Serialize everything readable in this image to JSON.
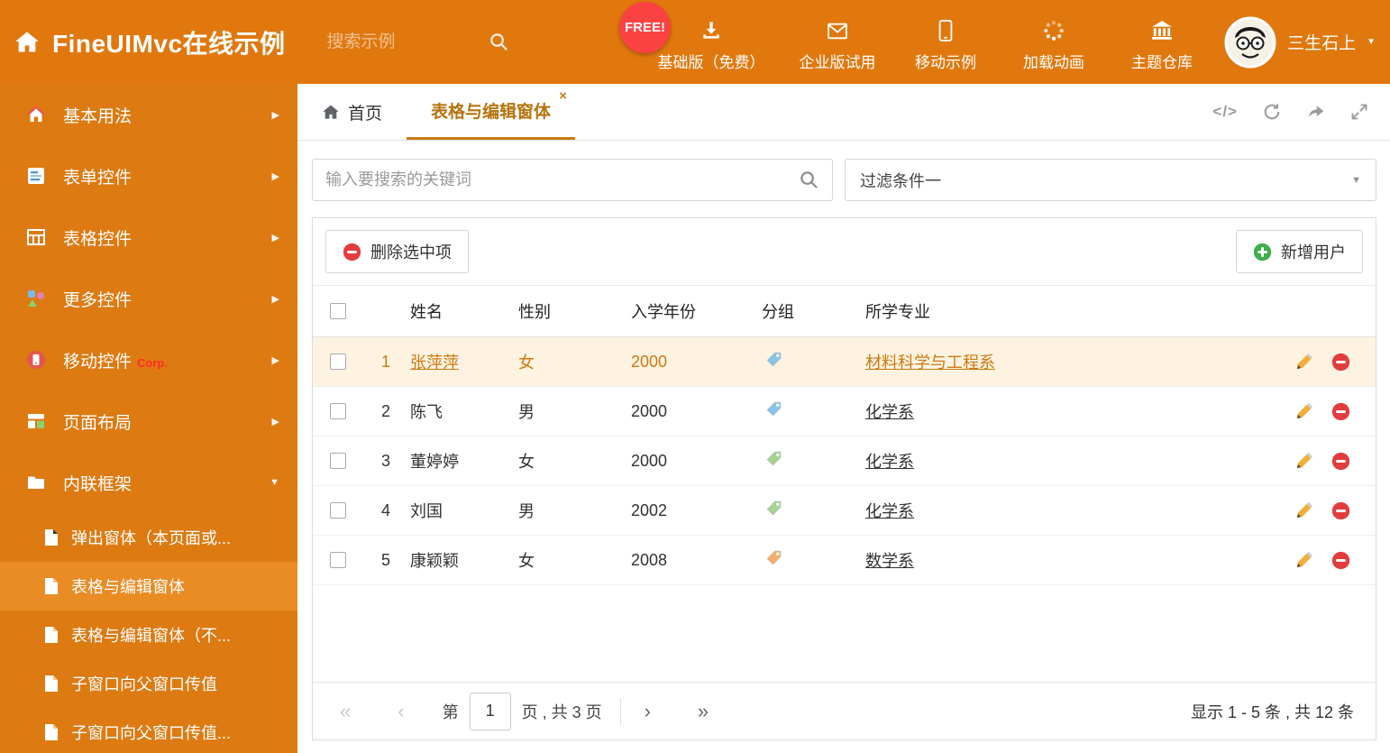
{
  "colors": {
    "header_bg": "#e1780e",
    "sidebar_bg": "#dd7a12",
    "sidebar_active_bg": "#ea8c24",
    "active_tab_accent": "#c87d0e",
    "selected_row_bg": "#fdf3e0",
    "selected_row_text": "#ce7a10",
    "free_badge_red": "#fb4242",
    "delete_red": "#e23d3d",
    "add_green": "#3fae49",
    "tag_blue": "#86c5ec",
    "tag_green": "#a5d491",
    "tag_orange": "#f4b06a"
  },
  "header": {
    "title": "FineUIMvc在线示例",
    "search_placeholder": "搜索示例",
    "free_badge": "FREE!",
    "nav": [
      {
        "icon": "download-icon",
        "label": "基础版（免费）"
      },
      {
        "icon": "envelope-icon",
        "label": "企业版试用"
      },
      {
        "icon": "mobile-icon",
        "label": "移动示例"
      },
      {
        "icon": "spinner-icon",
        "label": "加载动画"
      },
      {
        "icon": "bank-icon",
        "label": "主题仓库"
      }
    ],
    "user_name": "三生石上"
  },
  "sidebar": {
    "items": [
      {
        "icon": "home-icon",
        "label": "基本用法"
      },
      {
        "icon": "form-icon",
        "label": "表单控件"
      },
      {
        "icon": "table-icon",
        "label": "表格控件"
      },
      {
        "icon": "more-controls-icon",
        "label": "更多控件"
      },
      {
        "icon": "mobile-controls-icon",
        "label": "移动控件",
        "badge": "Corp."
      },
      {
        "icon": "layout-icon",
        "label": "页面布局"
      },
      {
        "icon": "iframe-icon",
        "label": "内联框架",
        "expanded": true
      }
    ],
    "subitems": [
      {
        "label": "弹出窗体（本页面或..."
      },
      {
        "label": "表格与编辑窗体",
        "active": true
      },
      {
        "label": "表格与编辑窗体（不..."
      },
      {
        "label": "子窗口向父窗口传值"
      },
      {
        "label": "子窗口向父窗口传值..."
      }
    ]
  },
  "tabs": {
    "home_label": "首页",
    "active_label": "表格与编辑窗体"
  },
  "filter": {
    "search_placeholder": "输入要搜索的关键词",
    "dropdown_value": "过滤条件一"
  },
  "toolbar": {
    "delete_label": "删除选中项",
    "add_label": "新增用户"
  },
  "table": {
    "headers": {
      "name": "姓名",
      "gender": "性别",
      "year": "入学年份",
      "group": "分组",
      "major": "所学专业"
    },
    "rows": [
      {
        "num": "1",
        "name": "张萍萍",
        "gender": "女",
        "year": "2000",
        "tag": "blue",
        "major": "材料科学与工程系",
        "selected": true
      },
      {
        "num": "2",
        "name": "陈飞",
        "gender": "男",
        "year": "2000",
        "tag": "blue",
        "major": "化学系"
      },
      {
        "num": "3",
        "name": "董婷婷",
        "gender": "女",
        "year": "2000",
        "tag": "green",
        "major": "化学系"
      },
      {
        "num": "4",
        "name": "刘国",
        "gender": "男",
        "year": "2002",
        "tag": "green",
        "major": "化学系"
      },
      {
        "num": "5",
        "name": "康颖颖",
        "gender": "女",
        "year": "2008",
        "tag": "orange",
        "major": "数学系"
      }
    ]
  },
  "pagination": {
    "prefix": "第",
    "page_value": "1",
    "suffix": "页 , 共 3 页",
    "summary": "显示 1 - 5 条 , 共 12 条"
  },
  "glyphs": {
    "close": "×",
    "caret_down": "▼",
    "arrow_right": "▶",
    "code": "</>",
    "pg_first": "«",
    "pg_prev": "‹",
    "pg_next": "›",
    "pg_last": "»"
  }
}
